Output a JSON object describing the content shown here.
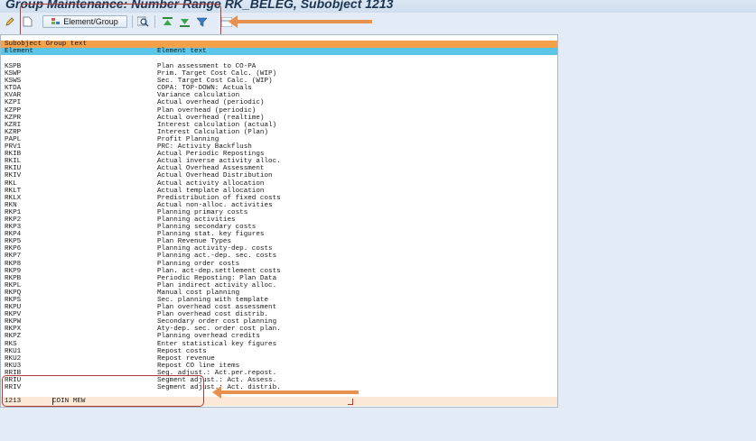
{
  "window": {
    "title": "Group Maintenance: Number Range RK_BELEG, Subobject 1213"
  },
  "toolbar": {
    "element_group_label": "Element/Group",
    "icons": [
      "pencil-icon",
      "new-document-icon",
      "element-group-icon",
      "find-icon",
      "move-top-icon",
      "move-bottom-icon",
      "filter-icon",
      "layout-icon"
    ]
  },
  "table": {
    "header_group_text": "Subobject Group text",
    "header_element": "Element",
    "header_element_text": "Element text",
    "rows": [
      {
        "element": "KSPB",
        "text": "Plan assessment to CO-PA"
      },
      {
        "element": "KSWP",
        "text": "Prim. Target Cost Calc. (WIP)"
      },
      {
        "element": "KSWS",
        "text": "Sec. Target Cost Calc. (WIP)"
      },
      {
        "element": "KTDA",
        "text": "COPA: TOP-DOWN: Actuals"
      },
      {
        "element": "KVAR",
        "text": "Variance calculation"
      },
      {
        "element": "KZPI",
        "text": "Actual overhead (periodic)"
      },
      {
        "element": "KZPP",
        "text": "Plan overhead (periodic)"
      },
      {
        "element": "KZPR",
        "text": "Actual overhead (realtime)"
      },
      {
        "element": "KZRI",
        "text": "Interest calculation (actual)"
      },
      {
        "element": "KZRP",
        "text": "Interest Calculation (Plan)"
      },
      {
        "element": "PAPL",
        "text": "Profit Planning"
      },
      {
        "element": "PRV1",
        "text": "PRC: Activity Backflush"
      },
      {
        "element": "RKIB",
        "text": "Actual Periodic Repostings"
      },
      {
        "element": "RKIL",
        "text": "Actual inverse activity alloc."
      },
      {
        "element": "RKIU",
        "text": "Actual Overhead Assessment"
      },
      {
        "element": "RKIV",
        "text": "Actual Overhead Distribution"
      },
      {
        "element": "RKL",
        "text": "Actual activity allocation"
      },
      {
        "element": "RKLT",
        "text": "Actual template allocation"
      },
      {
        "element": "RKLX",
        "text": "Predistribution of fixed costs"
      },
      {
        "element": "RKN",
        "text": "Actual non-alloc. activities"
      },
      {
        "element": "RKP1",
        "text": "Planning primary costs"
      },
      {
        "element": "RKP2",
        "text": "Planning activities"
      },
      {
        "element": "RKP3",
        "text": "Planning secondary costs"
      },
      {
        "element": "RKP4",
        "text": "Planning stat. key figures"
      },
      {
        "element": "RKP5",
        "text": "Plan Revenue Types"
      },
      {
        "element": "RKP6",
        "text": "Planning activity-dep. costs"
      },
      {
        "element": "RKP7",
        "text": "Planning act.-dep. sec. costs"
      },
      {
        "element": "RKP8",
        "text": "Planning order costs"
      },
      {
        "element": "RKP9",
        "text": "Plan. act-dep.settlement costs"
      },
      {
        "element": "RKPB",
        "text": "Periodic Reposting: Plan Data"
      },
      {
        "element": "RKPL",
        "text": "Plan indirect activity alloc."
      },
      {
        "element": "RKPQ",
        "text": "Manual cost planning"
      },
      {
        "element": "RKPS",
        "text": "Sec. planning with template"
      },
      {
        "element": "RKPU",
        "text": "Plan overhead cost assessment"
      },
      {
        "element": "RKPV",
        "text": "Plan overhead cost distrib."
      },
      {
        "element": "RKPW",
        "text": "Secondary order cost planning"
      },
      {
        "element": "RKPX",
        "text": "Aty-dep. sec. order cost plan."
      },
      {
        "element": "RKPZ",
        "text": "Planning overhead credits"
      },
      {
        "element": "RKS",
        "text": "Enter statistical key figures"
      },
      {
        "element": "RKU1",
        "text": "Repost costs"
      },
      {
        "element": "RKU2",
        "text": "Repost revenue"
      },
      {
        "element": "RKU3",
        "text": "Repost CO line items"
      },
      {
        "element": "RRIB",
        "text": "Seg. adjust.: Act.per.repost."
      },
      {
        "element": "RRIU",
        "text": "Segment adjust.: Act. Assess."
      },
      {
        "element": "RRIV",
        "text": "Segment adjust.: Act. distrib."
      }
    ],
    "footer_number": "1213",
    "footer_text": "COIN MEW"
  }
}
